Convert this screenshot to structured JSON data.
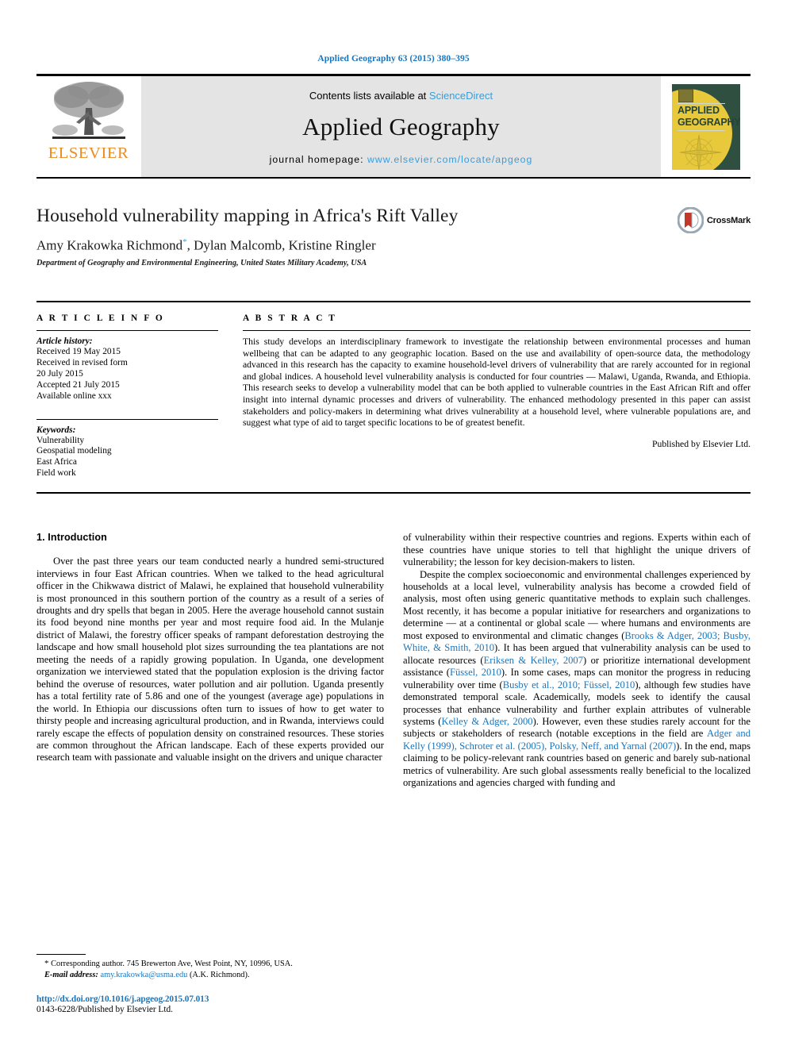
{
  "running_head": "Applied Geography 63 (2015) 380–395",
  "masthead": {
    "publisher_name": "ELSEVIER",
    "contents_prefix": "Contents lists available at ",
    "contents_link": "ScienceDirect",
    "journal_name": "Applied Geography",
    "homepage_prefix": "journal homepage: ",
    "homepage_url": "www.elsevier.com/locate/apgeog",
    "cover": {
      "line1": "APPLIED",
      "line2": "GEOGRAPHY"
    }
  },
  "article": {
    "title": "Household vulnerability mapping in Africa's Rift Valley",
    "authors": "Amy Krakowka Richmond",
    "authors_rest": ", Dylan Malcomb, Kristine Ringler",
    "corresponding_marker": "*",
    "affiliation": "Department of Geography and Environmental Engineering, United States Military Academy, USA",
    "crossmark_label": "CrossMark"
  },
  "info": {
    "heading": "A R T I C L E   I N F O",
    "history_label": "Article history:",
    "history": [
      "Received 19 May 2015",
      "Received in revised form",
      "20 July 2015",
      "Accepted 21 July 2015",
      "Available online xxx"
    ],
    "keywords_label": "Keywords:",
    "keywords": [
      "Vulnerability",
      "Geospatial modeling",
      "East Africa",
      "Field work"
    ]
  },
  "abstract": {
    "heading": "A B S T R A C T",
    "text": "This study develops an interdisciplinary framework to investigate the relationship between environmental processes and human wellbeing that can be adapted to any geographic location. Based on the use and availability of open-source data, the methodology advanced in this research has the capacity to examine household-level drivers of vulnerability that are rarely accounted for in regional and global indices. A household level vulnerability analysis is conducted for four countries — Malawi, Uganda, Rwanda, and Ethiopia. This research seeks to develop a vulnerability model that can be both applied to vulnerable countries in the East African Rift and offer insight into internal dynamic processes and drivers of vulnerability. The enhanced methodology presented in this paper can assist stakeholders and policy-makers in determining what drives vulnerability at a household level, where vulnerable populations are, and suggest what type of aid to target specific locations to be of greatest benefit.",
    "published_by": "Published by Elsevier Ltd."
  },
  "body": {
    "section_heading": "1. Introduction",
    "left_paragraphs": [
      "Over the past three years our team conducted nearly a hundred semi-structured interviews in four East African countries. When we talked to the head agricultural officer in the Chikwawa district of Malawi, he explained that household vulnerability is most pronounced in this southern portion of the country as a result of a series of droughts and dry spells that began in 2005. Here the average household cannot sustain its food beyond nine months per year and most require food aid. In the Mulanje district of Malawi, the forestry officer speaks of rampant deforestation destroying the landscape and how small household plot sizes surrounding the tea plantations are not meeting the needs of a rapidly growing population. In Uganda, one development organization we interviewed stated that the population explosion is the driving factor behind the overuse of resources, water pollution and air pollution. Uganda presently has a total fertility rate of 5.86 and one of the youngest (average age) populations in the world. In Ethiopia our discussions often turn to issues of how to get water to thirsty people and increasing agricultural production, and in Rwanda, interviews could rarely escape the effects of population density on constrained resources. These stories are common throughout the African landscape. Each of these experts provided our research team with passionate and valuable insight on the drivers and unique character"
    ],
    "right_paragraph_1_continuation": "of vulnerability within their respective countries and regions. Experts within each of these countries have unique stories to tell that highlight the unique drivers of vulnerability; the lesson for key decision-makers to listen.",
    "right_paragraph_2_parts": [
      {
        "t": "Despite the complex socioeconomic and environmental challenges experienced by households at a local level, vulnerability analysis has become a crowded field of analysis, most often using generic quantitative methods to explain such challenges. Most recently, it has become a popular initiative for researchers and organizations to determine — at a continental or global scale — where humans and environments are most exposed to environmental and climatic changes (",
        "c": false
      },
      {
        "t": "Brooks & Adger, 2003; Busby, White, & Smith, 2010",
        "c": true
      },
      {
        "t": "). It has been argued that vulnerability analysis can be used to allocate resources (",
        "c": false
      },
      {
        "t": "Eriksen & Kelley, 2007",
        "c": true
      },
      {
        "t": ") or prioritize international development assistance (",
        "c": false
      },
      {
        "t": "Füssel, 2010",
        "c": true
      },
      {
        "t": "). In some cases, maps can monitor the progress in reducing vulnerability over time (",
        "c": false
      },
      {
        "t": "Busby et al., 2010; Füssel, 2010",
        "c": true
      },
      {
        "t": "), although few studies have demonstrated temporal scale. Academically, models seek to identify the causal processes that enhance vulnerability and further explain attributes of vulnerable systems (",
        "c": false
      },
      {
        "t": "Kelley & Adger, 2000",
        "c": true
      },
      {
        "t": "). However, even these studies rarely account for the subjects or stakeholders of research (notable exceptions in the field are ",
        "c": false
      },
      {
        "t": "Adger and Kelly (1999), Schroter et al. (2005), Polsky, Neff, and Yarnal (2007)",
        "c": true
      },
      {
        "t": "). In the end, maps claiming to be policy-relevant rank countries based on generic and barely sub-national metrics of vulnerability. Are such global assessments really beneficial to the localized organizations and agencies charged with funding and",
        "c": false
      }
    ]
  },
  "footnote": {
    "marker": "*",
    "corresponding": " Corresponding author. 745 Brewerton Ave, West Point, NY, 10996, USA.",
    "email_label": "E-mail address:",
    "email": "amy.krakowka@usma.edu",
    "email_suffix": " (A.K. Richmond).",
    "doi": "http://dx.doi.org/10.1016/j.apgeog.2015.07.013",
    "issn_line": "0143-6228/Published by Elsevier Ltd."
  },
  "colors": {
    "link_blue": "#1b75bb",
    "sciencedirect_blue": "#3c9cd6",
    "elsevier_orange": "#ec8b22",
    "cover_green": "#2f4f41",
    "cover_yellow": "#e8c93c"
  }
}
